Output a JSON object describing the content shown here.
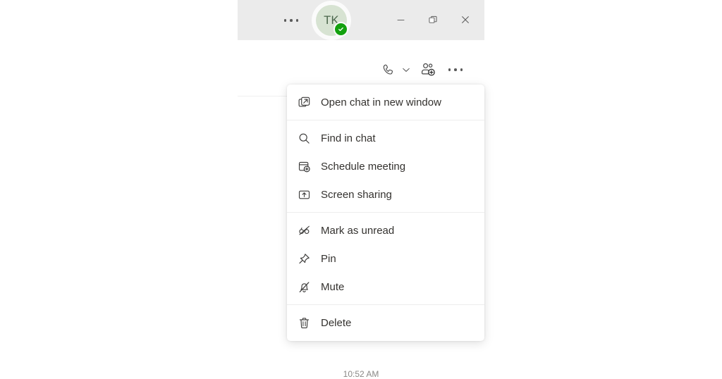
{
  "window": {
    "title_bar": {
      "overflow_icon": "ellipsis-horizontal-icon",
      "avatar": {
        "initials": "TK",
        "presence": "available",
        "presence_icon": "checkmark-icon",
        "bg_color": "#d7e3d2",
        "text_color": "#49654a",
        "presence_color": "#13a10e"
      },
      "controls": [
        {
          "name": "minimize",
          "icon": "minimize-icon"
        },
        {
          "name": "restore",
          "icon": "restore-window-icon"
        },
        {
          "name": "close",
          "icon": "close-icon"
        }
      ],
      "bg_color": "#ebebeb"
    },
    "chat_header": {
      "actions": [
        {
          "name": "call",
          "icon": "call-icon"
        },
        {
          "name": "call-options",
          "icon": "chevron-down-icon"
        },
        {
          "name": "add-people",
          "icon": "person-add-icon"
        },
        {
          "name": "more-options",
          "icon": "ellipsis-horizontal-icon"
        }
      ]
    }
  },
  "context_menu": {
    "groups": [
      {
        "items": [
          {
            "label": "Open chat in new window",
            "icon": "open-in-new-window-icon"
          }
        ]
      },
      {
        "items": [
          {
            "label": "Find in chat",
            "icon": "search-icon"
          },
          {
            "label": "Schedule meeting",
            "icon": "calendar-add-icon"
          },
          {
            "label": "Screen sharing",
            "icon": "screen-share-icon"
          }
        ]
      },
      {
        "items": [
          {
            "label": "Mark as unread",
            "icon": "mark-unread-icon"
          },
          {
            "label": "Pin",
            "icon": "pin-icon"
          },
          {
            "label": "Mute",
            "icon": "bell-off-icon"
          }
        ]
      },
      {
        "items": [
          {
            "label": "Delete",
            "icon": "trash-icon"
          }
        ]
      }
    ]
  },
  "message_area": {
    "timestamp": "10:52 AM"
  }
}
